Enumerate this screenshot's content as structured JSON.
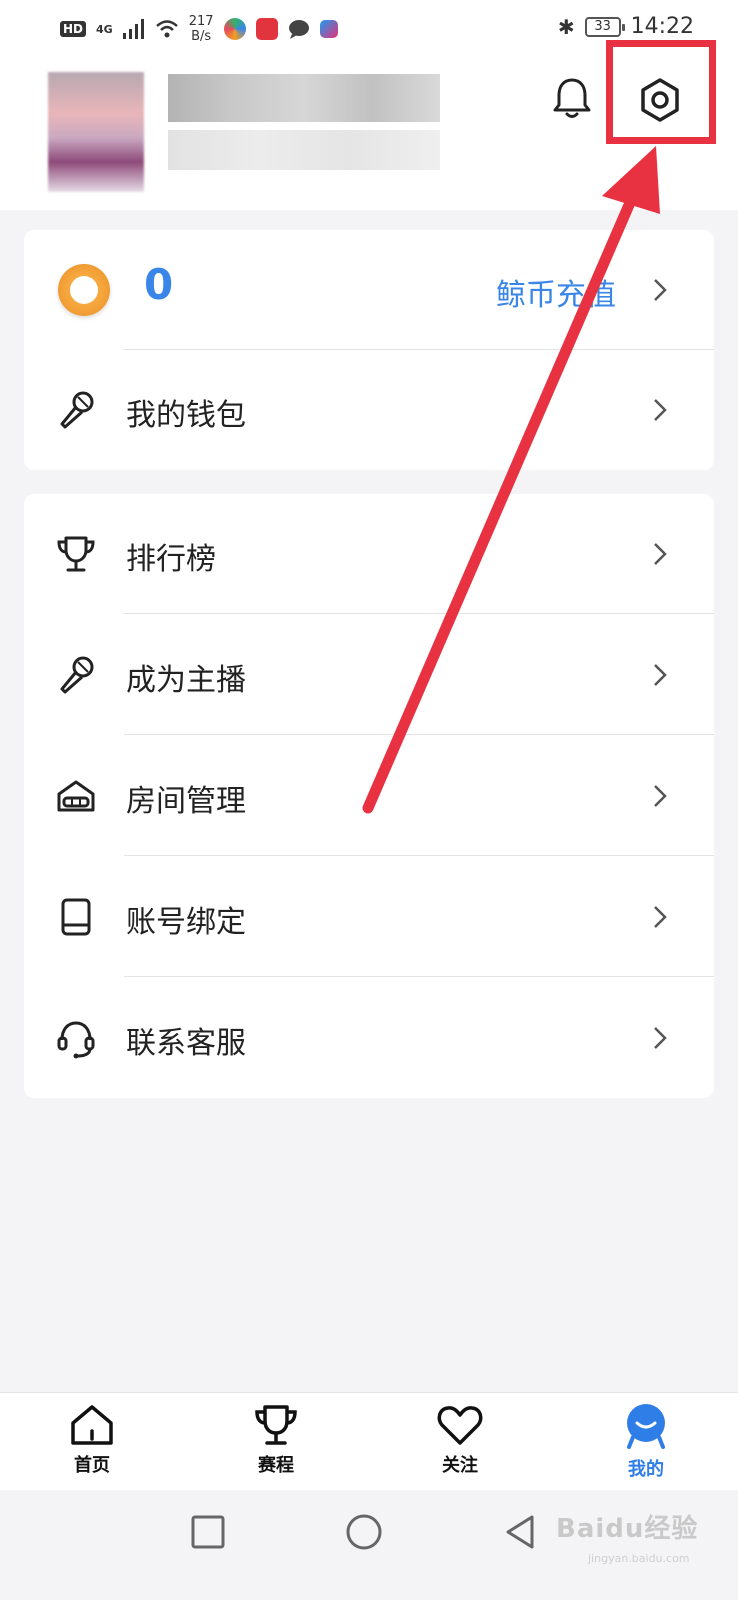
{
  "status_bar": {
    "hd": "HD",
    "network": "4G",
    "speed_value": "217",
    "speed_unit": "B/s",
    "battery": "33",
    "time": "14:22"
  },
  "wallet_card": {
    "coin_balance": "0",
    "recharge_label": "鲸币充值",
    "wallet_label": "我的钱包"
  },
  "menu": {
    "items": [
      {
        "label": "排行榜",
        "icon": "trophy-icon"
      },
      {
        "label": "成为主播",
        "icon": "microphone-icon"
      },
      {
        "label": "房间管理",
        "icon": "house-icon"
      },
      {
        "label": "账号绑定",
        "icon": "tablet-icon"
      },
      {
        "label": "联系客服",
        "icon": "headset-icon"
      }
    ]
  },
  "bottom_nav": {
    "items": [
      {
        "label": "首页",
        "icon": "home-icon",
        "active": false
      },
      {
        "label": "赛程",
        "icon": "trophy-icon",
        "active": false
      },
      {
        "label": "关注",
        "icon": "heart-icon",
        "active": false
      },
      {
        "label": "我的",
        "icon": "profile-icon",
        "active": true
      }
    ]
  },
  "colors": {
    "accent": "#3a85e8",
    "highlight": "#e83242",
    "coin": "#f3a33a",
    "background": "#f4f4f6"
  },
  "watermark": {
    "text": "Baidu经验",
    "sub": "jingyan.baidu.com"
  }
}
